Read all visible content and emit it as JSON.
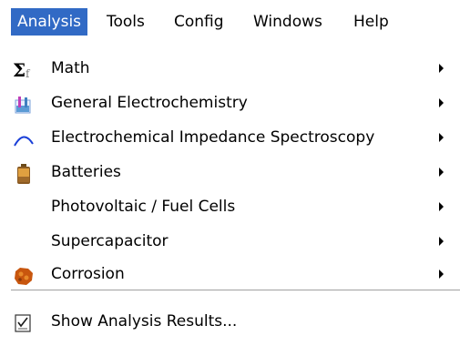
{
  "menubar": {
    "items": [
      {
        "label": "Analysis",
        "active": true
      },
      {
        "label": "Tools"
      },
      {
        "label": "Config"
      },
      {
        "label": "Windows"
      },
      {
        "label": "Help"
      }
    ]
  },
  "menu": {
    "items": [
      {
        "label": "Math",
        "icon": "sigma-icon",
        "submenu": true
      },
      {
        "label": "General Electrochemistry",
        "icon": "beaker-icon",
        "submenu": true
      },
      {
        "label": "Electrochemical Impedance Spectroscopy",
        "icon": "arc-icon",
        "submenu": true
      },
      {
        "label": "Batteries",
        "icon": "battery-icon",
        "submenu": true
      },
      {
        "label": "Photovoltaic / Fuel Cells",
        "icon": "",
        "submenu": true
      },
      {
        "label": "Supercapacitor",
        "icon": "",
        "submenu": true
      },
      {
        "label": "Corrosion",
        "icon": "rust-icon",
        "submenu": true
      }
    ],
    "footer_item": {
      "label": "Show Analysis Results...",
      "icon": "checklist-icon"
    }
  },
  "colors": {
    "highlight": "#316ac5",
    "separator": "#a0a0a0"
  }
}
